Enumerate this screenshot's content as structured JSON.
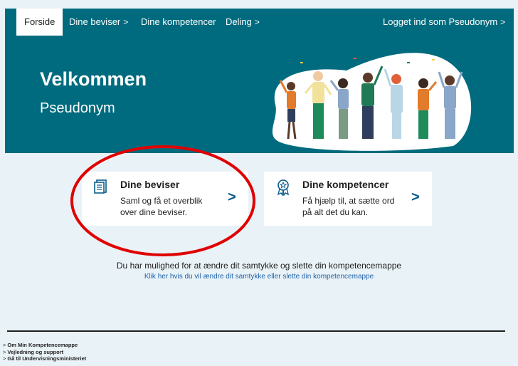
{
  "nav": {
    "items": [
      {
        "label": "Forside",
        "chevron": ""
      },
      {
        "label": "Dine beviser",
        "chevron": ">"
      },
      {
        "label": "Dine kompetencer",
        "chevron": ""
      },
      {
        "label": "Deling",
        "chevron": ">"
      }
    ],
    "login": {
      "label": "Logget ind som Pseudonym",
      "chevron": ">"
    }
  },
  "hero": {
    "title": "Velkommen",
    "subtitle": "Pseudonym",
    "background_color": "#006b7e",
    "illustration": "celebrating-people-illustration"
  },
  "cards": [
    {
      "title": "Dine beviser",
      "text": "Saml og få et overblik over dine beviser.",
      "icon": "document-stack-icon",
      "chevron": ">"
    },
    {
      "title": "Dine kompetencer",
      "text": "Få hjælp til, at sætte ord på alt det du kan.",
      "icon": "award-ribbon-icon",
      "chevron": ">"
    }
  ],
  "consent": {
    "text": "Du har mulighed for at ændre dit samtykke og slette din kompetencemappe",
    "link": "Klik her hvis du vil ændre dit samtykke eller slette din kompetencemappe"
  },
  "footer": {
    "links": [
      {
        "chevron": ">",
        "label": "Om Min Kompetencemappe"
      },
      {
        "chevron": ">",
        "label": "Vejledning og support"
      },
      {
        "chevron": ">",
        "label": "Gå til Undervisningsministeriet"
      }
    ]
  },
  "colors": {
    "accent": "#0a5c8a",
    "link": "#1e63a8",
    "annotation": "#e00000",
    "page_background": "#e9f2f7"
  }
}
